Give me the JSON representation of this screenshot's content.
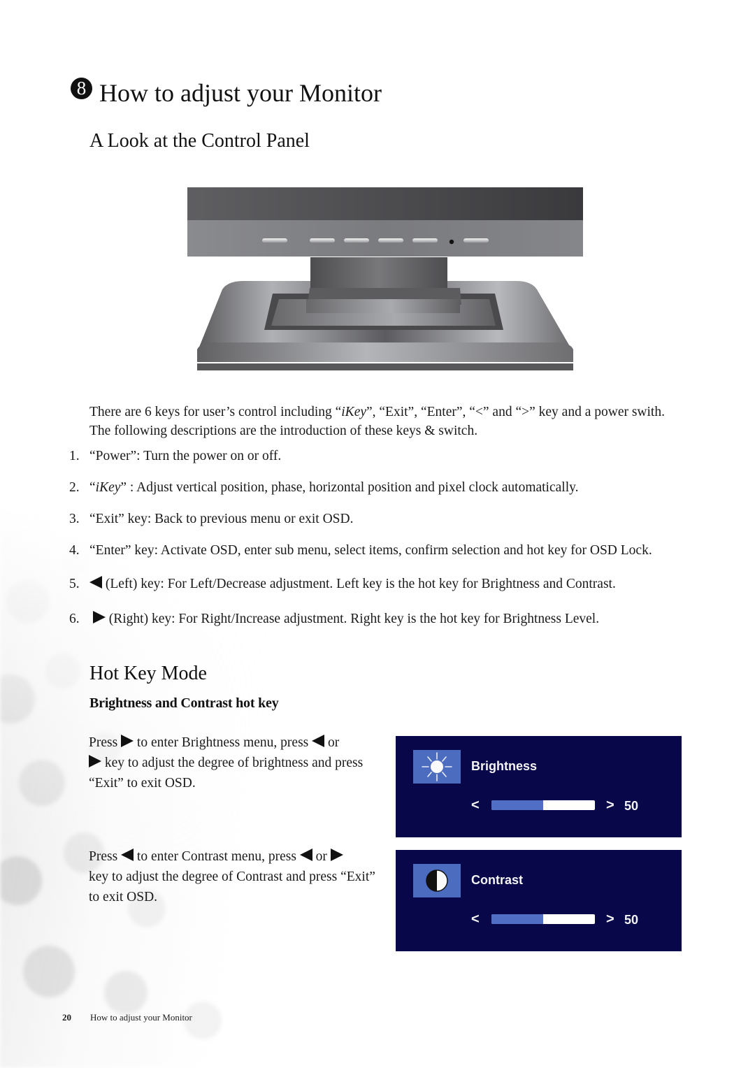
{
  "chapter": {
    "number": "8",
    "title": "How to adjust your Monitor"
  },
  "section1": {
    "title": "A Look at the Control Panel"
  },
  "figure": {
    "name": "monitor-control-panel",
    "button_count": 6,
    "power_led": true
  },
  "intro": {
    "part1": "There are 6 keys for user’s control including “",
    "ikey": "iKey",
    "part2": "”, “Exit”, “Enter”, “<” and “>” key and a power swith. The following descriptions are the introduction of these keys & switch."
  },
  "list": [
    {
      "num": "1.",
      "text": "“Power”: Turn the power on or off."
    },
    {
      "num": "2.",
      "pre": "“",
      "ikey": "iKey",
      "text": "” : Adjust vertical position, phase, horizontal position and pixel clock automatically."
    },
    {
      "num": "3.",
      "text": "“Exit” key: Back to previous menu or exit OSD."
    },
    {
      "num": "4.",
      "text": "“Enter” key: Activate OSD, enter sub menu, select items, confirm selection and hot key for OSD Lock."
    },
    {
      "num": "5.",
      "icon": "left-triangle",
      "text": " (Left) key: For Left/Decrease adjustment. Left key is the hot key for Brightness and Contrast."
    },
    {
      "num": "6.",
      "icon": "right-triangle",
      "text": " (Right) key: For Right/Increase adjustment. Right key is the hot key for Brightness Level."
    }
  ],
  "section2": {
    "title": "Hot Key Mode",
    "subtitle": "Brightness and Contrast hot key"
  },
  "brightness_para": {
    "a": "Press ",
    "b": " to enter Brightness menu, press ",
    "c": " or",
    "d": " key to adjust the degree of brightness and press “Exit” to exit OSD."
  },
  "contrast_para": {
    "a": "Press ",
    "b": " to enter Contrast menu, press ",
    "c": " or ",
    "d": "key to adjust the degree of Contrast and press “Exit” to exit OSD."
  },
  "osd": [
    {
      "label": "Brightness",
      "icon": "sun-icon",
      "left_arrow": "<",
      "right_arrow": ">",
      "value": "50",
      "level_percent": 50
    },
    {
      "label": "Contrast",
      "icon": "contrast-icon",
      "left_arrow": "<",
      "right_arrow": ">",
      "value": "50",
      "level_percent": 50
    }
  ],
  "colors": {
    "osd_bg": "#07074a",
    "osd_accent": "#4c6cc0"
  },
  "footer": {
    "page": "20",
    "title": "How to adjust your Monitor"
  }
}
